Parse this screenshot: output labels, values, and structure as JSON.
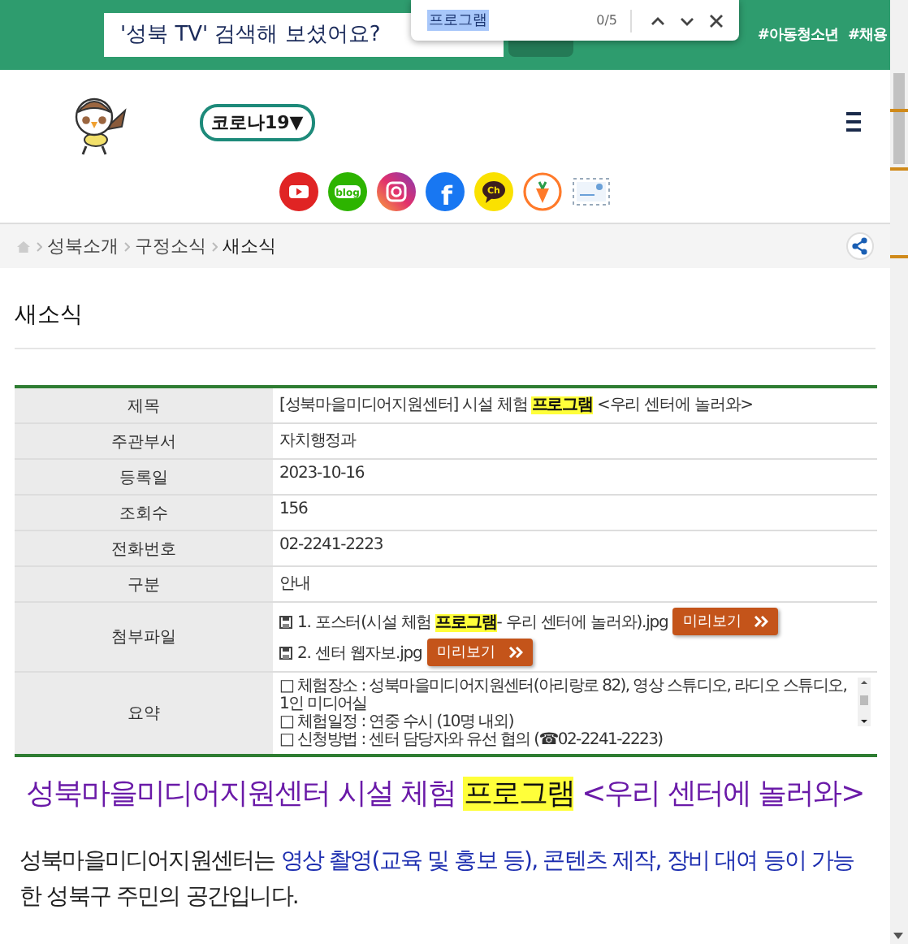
{
  "find_bar": {
    "query": "프로그램",
    "count": "0/5"
  },
  "header": {
    "search": {
      "placeholder": "'성북 TV' 검색해 보셨어요?"
    },
    "hashtags": [
      "#아동청소년",
      "#채용"
    ]
  },
  "covid_button": {
    "label": "코로나19▼"
  },
  "social_links": [
    {
      "kind": "youtube"
    },
    {
      "kind": "blog",
      "label": "blog"
    },
    {
      "kind": "instagram"
    },
    {
      "kind": "facebook",
      "label": "f"
    },
    {
      "kind": "kakao",
      "label": "Ch"
    },
    {
      "kind": "carrot"
    },
    {
      "kind": "letter"
    }
  ],
  "breadcrumb": [
    "성북소개",
    "구정소식",
    "새소식"
  ],
  "page_title": "새소식",
  "table": {
    "rows": [
      {
        "kind": "text",
        "label": "제목",
        "segments": [
          {
            "text": "[성북마을미디어지원센터] 시설 체험 ",
            "highlighted": false
          },
          {
            "text": "프로그램",
            "highlighted": true
          },
          {
            "text": " <우리 센터에 놀러와>",
            "highlighted": false
          }
        ]
      },
      {
        "kind": "text",
        "label": "주관부서",
        "segments": [
          {
            "text": "자치행정과",
            "highlighted": false
          }
        ]
      },
      {
        "kind": "text",
        "label": "등록일",
        "segments": [
          {
            "text": "2023-10-16",
            "highlighted": false
          }
        ]
      },
      {
        "kind": "text",
        "label": "조회수",
        "segments": [
          {
            "text": "156",
            "highlighted": false
          }
        ]
      },
      {
        "kind": "text",
        "label": "전화번호",
        "segments": [
          {
            "text": "02-2241-2223",
            "highlighted": false
          }
        ]
      },
      {
        "kind": "text",
        "label": "구분",
        "segments": [
          {
            "text": "안내",
            "highlighted": false
          }
        ]
      },
      {
        "kind": "files",
        "label": "첨부파일",
        "files": [
          {
            "segments": [
              {
                "text": "1. 포스터(시설 체험 ",
                "highlighted": false
              },
              {
                "text": "프로그램",
                "highlighted": true
              },
              {
                "text": "- 우리 센터에 놀러와).jpg",
                "highlighted": false
              }
            ],
            "button": "미리보기"
          },
          {
            "segments": [
              {
                "text": "2. 센터 웹자보.jpg",
                "highlighted": false
              }
            ],
            "button": "미리보기"
          }
        ]
      },
      {
        "kind": "summary",
        "label": "요약",
        "lines": [
          "□ 체험장소 : 성북마을미디어지원센터(아리랑로 82), 영상 스튜디오, 라디오 스튜디오, 1인 미디어실",
          "□ 체험일정 : 연중 수시 (10명 내외)",
          "□ 신청방법 : 센터 담당자와 유선 협의 (☎02-2241-2223)"
        ]
      }
    ]
  },
  "article": {
    "heading": [
      {
        "text": "성북마을미디어지원센터 시설 체험 ",
        "highlighted": false
      },
      {
        "text": "프로그램",
        "highlighted": true
      },
      {
        "text": " <우리 센터에 놀러와>",
        "highlighted": false
      }
    ],
    "paragraph": [
      {
        "text": "성북마을미디어지원센터는 ",
        "emphasis": false
      },
      {
        "text": "영상 촬영(교육 및 홍보 등), 콘텐츠 제작, 장비 대여 등이 가능",
        "emphasis": true
      },
      {
        "text": "한 성북구 주민의 공간입니다.",
        "emphasis": false
      }
    ]
  }
}
